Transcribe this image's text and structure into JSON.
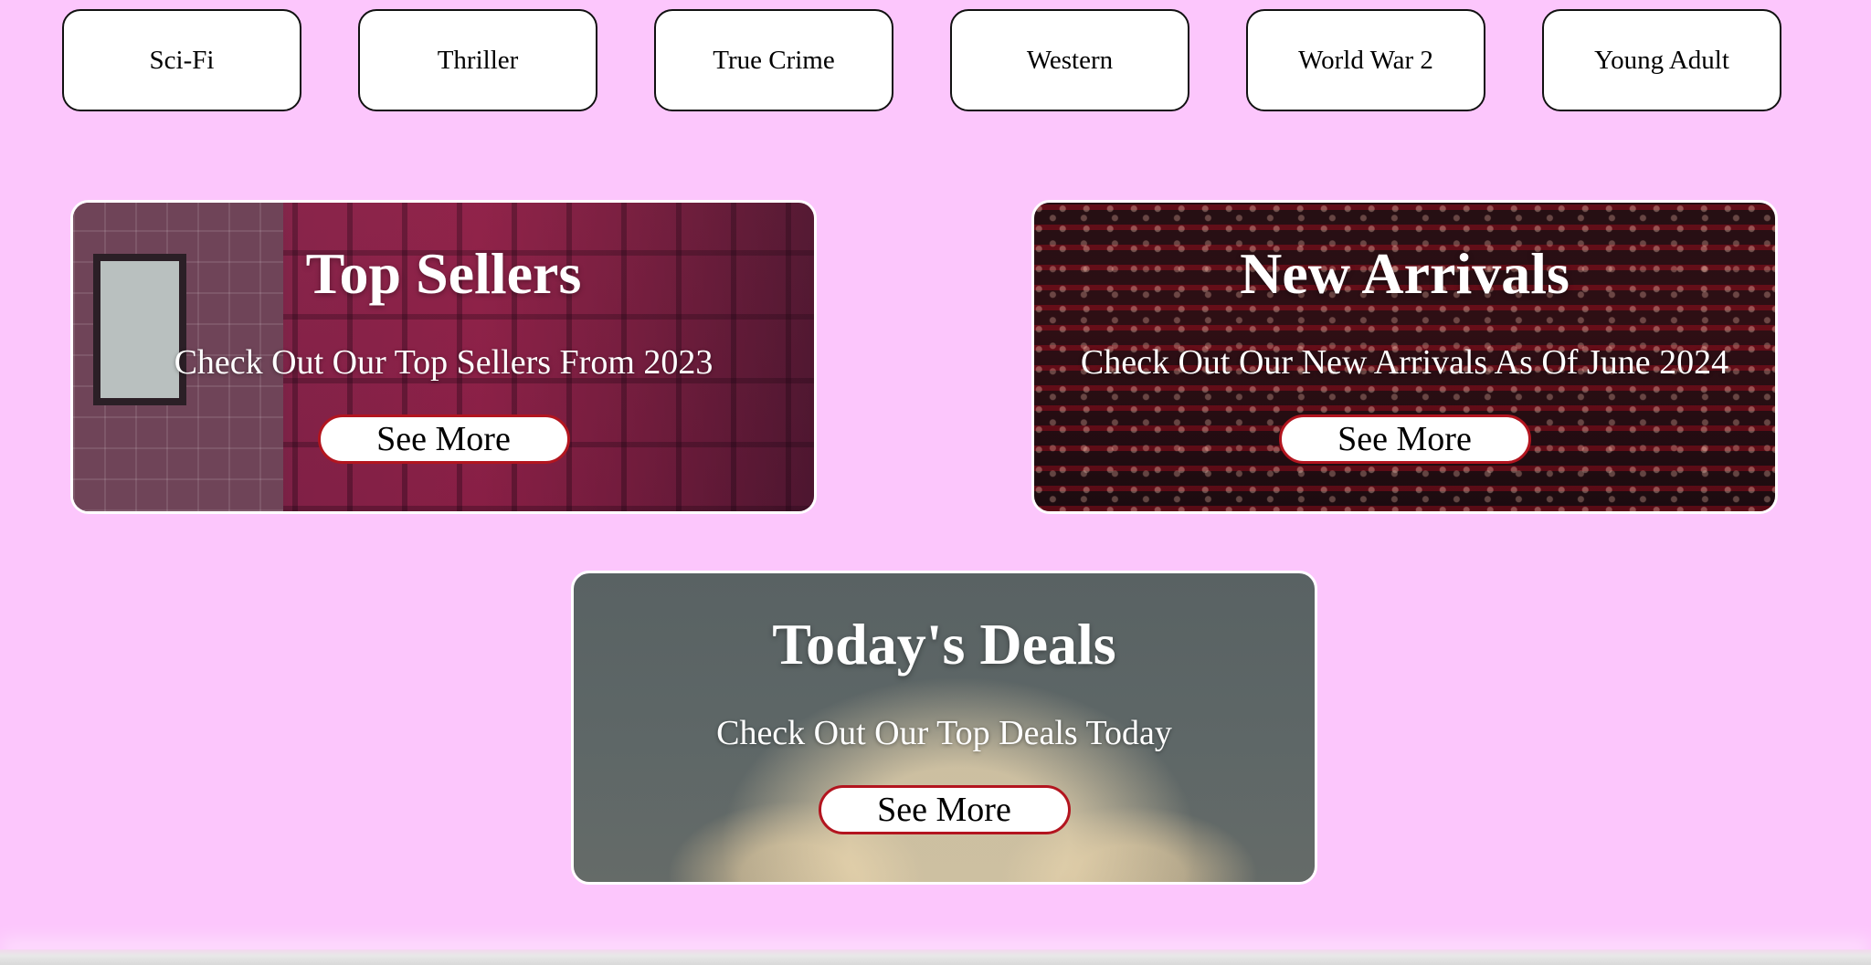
{
  "genres": [
    {
      "label": "Sci-Fi"
    },
    {
      "label": "Thriller"
    },
    {
      "label": "True Crime"
    },
    {
      "label": "Western"
    },
    {
      "label": "World War 2"
    },
    {
      "label": "Young Adult"
    }
  ],
  "cards": {
    "top_sellers": {
      "title": "Top Sellers",
      "subtitle": "Check Out Our Top Sellers From 2023",
      "button": "See More"
    },
    "new_arrivals": {
      "title": "New Arrivals",
      "subtitle": "Check Out Our New Arrivals As Of June 2024",
      "button": "See More"
    },
    "todays_deals": {
      "title": "Today's Deals",
      "subtitle": "Check Out Our Top Deals Today",
      "button": "See More"
    }
  },
  "colors": {
    "page_background": "#fcc6fc",
    "button_border_accent": "#b3151f"
  }
}
